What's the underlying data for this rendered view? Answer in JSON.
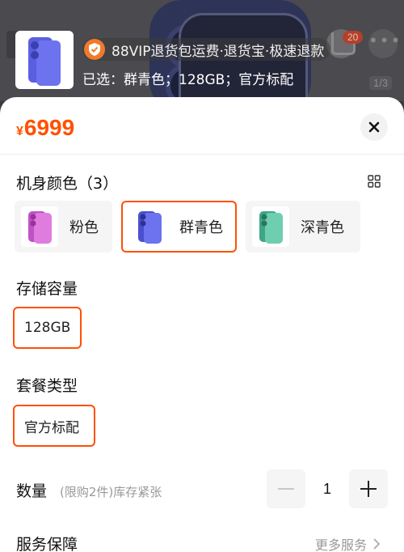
{
  "background": {
    "cart_badge": "20",
    "image_counter": "1/3"
  },
  "header": {
    "vip_text": "88VIP退货包运费·退货宝·极速退款",
    "selected_text": "已选：群青色；128GB；官方标配"
  },
  "sheet": {
    "currency": "¥",
    "price": "6999"
  },
  "color_section": {
    "title": "机身颜色（3）",
    "options": [
      {
        "label": "粉色",
        "color": "#d86bd6",
        "selected": false
      },
      {
        "label": "群青色",
        "color": "#5a5fe0",
        "selected": true
      },
      {
        "label": "深青色",
        "color": "#5fbfa3",
        "selected": false
      }
    ]
  },
  "storage_section": {
    "title": "存储容量",
    "option": "128GB"
  },
  "package_section": {
    "title": "套餐类型",
    "option": "官方标配"
  },
  "quantity": {
    "label": "数量",
    "note": "(限购2件)库存紧张",
    "value": "1"
  },
  "service": {
    "label": "服务保障",
    "more": "更多服务"
  },
  "colors": {
    "accent": "#ff5000",
    "selected_border": "#ff5000"
  }
}
